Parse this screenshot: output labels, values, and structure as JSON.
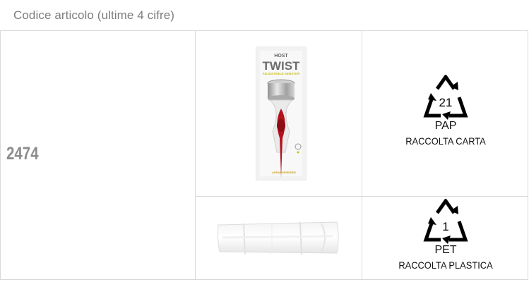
{
  "header": {
    "title": "Codice articolo (ultime 4 cifre)"
  },
  "article": {
    "code": "2474"
  },
  "box": {
    "brand_top": "HOST",
    "brand_name": "TWIST",
    "brand_sub": "ADJUSTABLE AERATOR",
    "series": "AERATORSERIES"
  },
  "recycling": [
    {
      "number": "21",
      "material": "PAP",
      "collection": "RACCOLTA CARTA"
    },
    {
      "number": "1",
      "material": "PET",
      "collection": "RACCOLTA PLASTICA"
    }
  ],
  "colors": {
    "border": "#d9d9d9",
    "header_text": "#7d7d7d",
    "code_text": "#8c8c8c",
    "accent_red": "#b3121d",
    "accent_yellow": "#c9c21a"
  }
}
